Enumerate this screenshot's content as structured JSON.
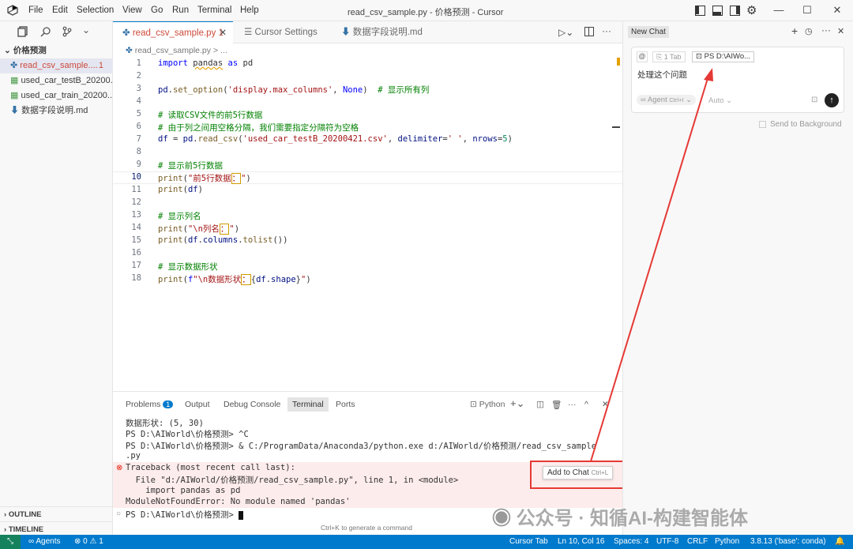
{
  "menu": [
    "File",
    "Edit",
    "Selection",
    "View",
    "Go",
    "Run",
    "Terminal",
    "Help"
  ],
  "window_title": "read_csv_sample.py - 价格预测 - Cursor",
  "explorer": {
    "folder": "价格预测",
    "files": [
      {
        "name": "read_csv_sample....",
        "badge": "1"
      },
      {
        "name": "used_car_testB_20200..."
      },
      {
        "name": "used_car_train_20200..."
      },
      {
        "name": "数据字段说明.md"
      }
    ]
  },
  "outline_label": "OUTLINE",
  "timeline_label": "TIMELINE",
  "tabs": [
    {
      "label": "read_csv_sample.py",
      "badge": "1"
    },
    {
      "label": "Cursor Settings"
    },
    {
      "label": "数据字段说明.md"
    }
  ],
  "breadcrumb": "read_csv_sample.py > ...",
  "line_numbers": [
    "1",
    "2",
    "3",
    "4",
    "5",
    "6",
    "7",
    "8",
    "9",
    "10",
    "11",
    "12",
    "13",
    "14",
    "15",
    "16",
    "17",
    "18"
  ],
  "panel_tabs": [
    "Problems",
    "Output",
    "Debug Console",
    "Terminal",
    "Ports"
  ],
  "problems_count": "1",
  "terminal_shell": "Python",
  "terminal_lines": [
    "数据形状: (5, 30)",
    "PS D:\\AIWorld\\价格预测> ^C",
    "PS D:\\AIWorld\\价格预测> & C:/ProgramData/Anaconda3/python.exe d:/AIWorld/价格预测/read_csv_sample",
    ".py",
    "Traceback (most recent call last):",
    "  File \"d:/AIWorld/价格预测/read_csv_sample.py\", line 1, in <module>",
    "    import pandas as pd",
    "ModuleNotFoundError: No module named 'pandas'",
    "PS D:\\AIWorld\\价格预测> "
  ],
  "add_to_chat": {
    "label": "Add to Chat",
    "shortcut": "Ctrl+L"
  },
  "generate_hint": "Ctrl+K to generate a command",
  "chat": {
    "title": "New Chat",
    "context_tab": "1 Tab",
    "context_terminal": "PS D:\\AIWo...",
    "message": "处理这个问题",
    "mode": "Agent",
    "mode_shortcut": "Ctrl+I",
    "model": "Auto",
    "send_background": "Send to Background"
  },
  "watermark": "公众号 · 知循AI-构建智能体",
  "status": {
    "agents": "Agents",
    "errors": "0",
    "warnings": "1",
    "cursor_tab": "Cursor Tab",
    "position": "Ln 10, Col 16",
    "spaces": "Spaces: 4",
    "encoding": "UTF-8",
    "eol": "CRLF",
    "language": "Python",
    "interpreter": "3.8.13 ('base': conda)"
  },
  "colors": {
    "accent": "#007acc",
    "error": "#e51400",
    "highlight_red": "#e53935"
  }
}
